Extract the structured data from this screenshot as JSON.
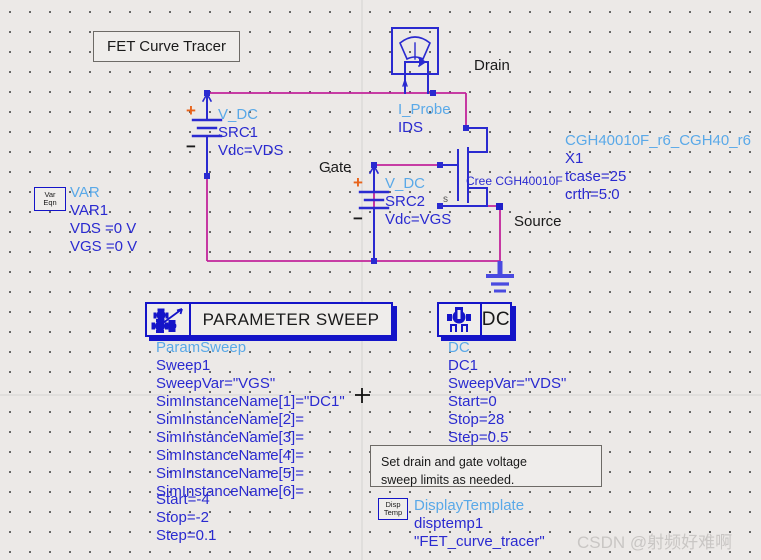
{
  "app": {
    "title": "FET Curve Tracer schematic",
    "canvas_bg": "#ece9e7",
    "grid_spacing_px": 20
  },
  "title_box": {
    "label": "FET Curve Tracer"
  },
  "node_labels": {
    "drain": "Drain",
    "gate": "Gate",
    "source": "Source"
  },
  "var_block": {
    "icon_line1": "Var",
    "icon_line2": "Eqn",
    "type": "VAR",
    "name": "VAR1",
    "params": [
      "VDS =0 V",
      "VGS =0 V"
    ]
  },
  "src1": {
    "type": "V_DC",
    "name": "SRC1",
    "param": "Vdc=VDS",
    "plus": "+",
    "minus": "−"
  },
  "src2": {
    "type": "V_DC",
    "name": "SRC2",
    "param": "Vdc=VGS",
    "plus": "+",
    "minus": "−"
  },
  "iprobe": {
    "type": "I_Probe",
    "name": "IDS"
  },
  "fet": {
    "symbol_label": "Cree CGH40010F",
    "source_pin": "s",
    "model": "CGH40010F_r6_CGH40_r6",
    "instance": "X1",
    "params": [
      "tcase=25",
      "crth=5.0"
    ]
  },
  "param_sweep": {
    "header": "PARAMETER SWEEP",
    "icon_name": "param-sweep-icon",
    "type": "ParamSweep",
    "name": "Sweep1",
    "params": [
      "SweepVar=\"VGS\"",
      "SimInstanceName[1]=\"DC1\"",
      "SimInstanceName[2]=",
      "SimInstanceName[3]=",
      "SimInstanceName[4]=",
      "SimInstanceName[5]=",
      "SimInstanceName[6]=",
      "Start=-4",
      "Stop=-2",
      "Step=0.1"
    ]
  },
  "dc_block": {
    "header": "DC",
    "icon_name": "dc-sim-icon",
    "type": "DC",
    "name": "DC1",
    "params": [
      "SweepVar=\"VDS\"",
      "Start=0",
      "Stop=28",
      "Step=0.5"
    ]
  },
  "note": {
    "line1": "Set drain and gate voltage",
    "line2": "sweep limits as needed."
  },
  "display_template": {
    "icon_line1": "Disp",
    "icon_line2": "Temp",
    "type": "DisplayTemplate",
    "name": "disptemp1",
    "value": "\"FET_curve_tracer\""
  },
  "watermark": {
    "text": "CSDN @射频好难啊"
  },
  "colors": {
    "wire": "#c2249a",
    "symbol_blue": "#2a2ad0",
    "label_cyan": "#5aa9e8",
    "plus_orange": "#e8631a",
    "text_black": "#1a1a1a"
  }
}
